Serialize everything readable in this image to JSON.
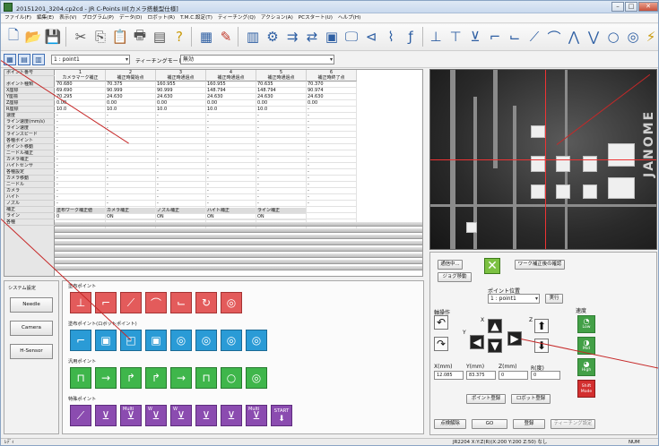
{
  "window": {
    "title": "20151201_3204.cp2cd - JR C-Points III[カメラ搭載型仕様]"
  },
  "menu": [
    "ファイル(F)",
    "編集(E)",
    "表示(V)",
    "プログラム(P)",
    "データ(D)",
    "ロボット(R)",
    "T.M.C.設定(T)",
    "ティーチング(Q)",
    "アクション(A)",
    "PCスタート(U)",
    "ヘルプ(H)"
  ],
  "toolbar2": {
    "point_select": "1 : point1",
    "teaching_mode": "ティーチングモード",
    "teaching_value": "無効"
  },
  "grid": {
    "row_headers": [
      "ポイント番号",
      "ポイント種類",
      "X座標",
      "Y座標",
      "Z座標",
      "R座標",
      "速度",
      "ライン速度(mm/s)",
      "ライン速度",
      "ラインスピード",
      "各種ポイント",
      "ポイント移動",
      "ニードル補正",
      "カメラ補正",
      "ハイトセンサ",
      "各種設定",
      "カメラ移動",
      "ニードル",
      "カメラ",
      "ハイト",
      "ノズル",
      "補正",
      "ライン",
      "各種"
    ],
    "columns": [
      {
        "no": "1",
        "name": "カメラマーク補正",
        "vals": [
          "70.680",
          "69.690",
          "70.295",
          "0.00",
          "10.0"
        ]
      },
      {
        "no": "2",
        "name": "補正時開始点",
        "vals": [
          "70.375",
          "90.999",
          "24.630",
          "0.00",
          "10.0"
        ]
      },
      {
        "no": "3",
        "name": "補正時通過点",
        "vals": [
          "160.955",
          "90.999",
          "24.630",
          "0.00",
          "10.0"
        ]
      },
      {
        "no": "4",
        "name": "補正時通過点",
        "vals": [
          "160.955",
          "148.794",
          "24.630",
          "0.00",
          "10.0"
        ]
      },
      {
        "no": "5",
        "name": "補正時通過点",
        "vals": [
          "70.635",
          "148.794",
          "24.630",
          "0.00",
          "10.0"
        ]
      },
      {
        "no": "6",
        "name": "補正時終了点",
        "vals": [
          "70.370",
          "90.974",
          "24.630",
          "0.00",
          "-"
        ]
      }
    ],
    "lower_header": [
      "塗布ワーク補正値",
      "カメラ補正",
      "ノズル補正",
      "ハイト補正",
      "ライン補正"
    ],
    "lower_values": [
      "0",
      "ON",
      "ON",
      "ON",
      "ON"
    ]
  },
  "system": {
    "title": "システム設定",
    "buttons": [
      "Needle",
      "Camera",
      "H-Sensor"
    ]
  },
  "commands": {
    "group1": "塗布ポイント",
    "group2": "塗布ポイント(ロボットポイント)",
    "group3": "汎用ポイント",
    "group4": "特殊ポイント",
    "multi_label": "Multi",
    "w_label": "W",
    "start_label": "START"
  },
  "control": {
    "running": "通信中...",
    "work_check": "ワーク補正後の確認",
    "jog_mode": "ジョグ移動",
    "point_label": "ポイント位置",
    "point_value": "1 : point1",
    "exec": "実行",
    "axis_label": "軸操作",
    "speed_label": "速度",
    "speed_low": "Low",
    "speed_mid": "Mid",
    "speed_high": "High",
    "shift": "Shift Mode",
    "x_label": "X(mm)",
    "y_label": "Y(mm)",
    "z_label": "Z(mm)",
    "r_label": "R(度)",
    "x_val": "12.085",
    "y_val": "83.375",
    "z_val": "0",
    "r_val": "0",
    "point_register": "ポイント登録",
    "robot_register": "ロボット登録",
    "cancel_btn": "点検解除",
    "go_btn": "GO",
    "register_btn": "登録",
    "teach_btn": "ティーチング設定"
  },
  "status": {
    "left": "ﾚﾃﾞｨ",
    "coords": "JR2204  X:Y:Z(R)(X:200  Y:200  Z:50)  なし",
    "num": "NUM"
  }
}
